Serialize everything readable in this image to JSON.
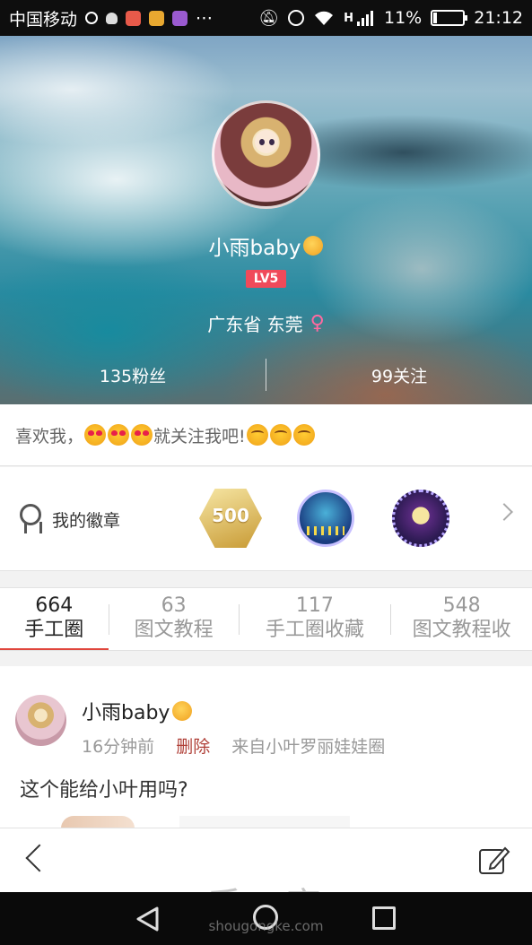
{
  "status_bar": {
    "carrier": "中国移动",
    "signal_type": "H",
    "battery_percent": "11%",
    "battery_level": 0.11,
    "time": "21:12",
    "icons": [
      "sync-icon",
      "octopus-icon",
      "mail-app-icon",
      "wallet-app-icon",
      "gallery-app-icon",
      "more-dots-icon",
      "mute-icon",
      "alarm-icon",
      "wifi-icon",
      "signal-icon",
      "battery-icon"
    ]
  },
  "profile": {
    "username": "小雨baby",
    "level": "LV5",
    "location": "广东省 东莞",
    "gender_icon": "female-icon",
    "fans": "135粉丝",
    "following": "99关注"
  },
  "signature": {
    "text_before": "喜欢我，",
    "text_mid": "就关注我吧!",
    "emoji_before": [
      "heart-eyes-emoji",
      "heart-eyes-emoji",
      "heart-eyes-emoji"
    ],
    "emoji_after": [
      "smile-emoji",
      "smile-emoji",
      "smile-emoji"
    ]
  },
  "badges": {
    "title": "我的徽章",
    "items": [
      {
        "name": "badge-500",
        "label": "500"
      },
      {
        "name": "badge-forest",
        "label": ""
      },
      {
        "name": "badge-night",
        "label": ""
      }
    ]
  },
  "tabs": [
    {
      "count": "664",
      "label": "手工圈",
      "active": true
    },
    {
      "count": "63",
      "label": "图文教程",
      "active": false
    },
    {
      "count": "117",
      "label": "手工圈收藏",
      "active": false
    },
    {
      "count": "548",
      "label": "图文教程收",
      "active": false
    }
  ],
  "post": {
    "username": "小雨baby",
    "time": "16分钟前",
    "delete_label": "删除",
    "source": "来自小叶罗丽娃娃圈",
    "text": "这个能给小叶用吗?"
  },
  "toolbar": {
    "watermark": "手工客",
    "watermark_sub": "shougongke.com"
  },
  "colors": {
    "accent_red": "#e0463c",
    "level_badge": "#f04a5a",
    "delete_text": "#b04038"
  }
}
